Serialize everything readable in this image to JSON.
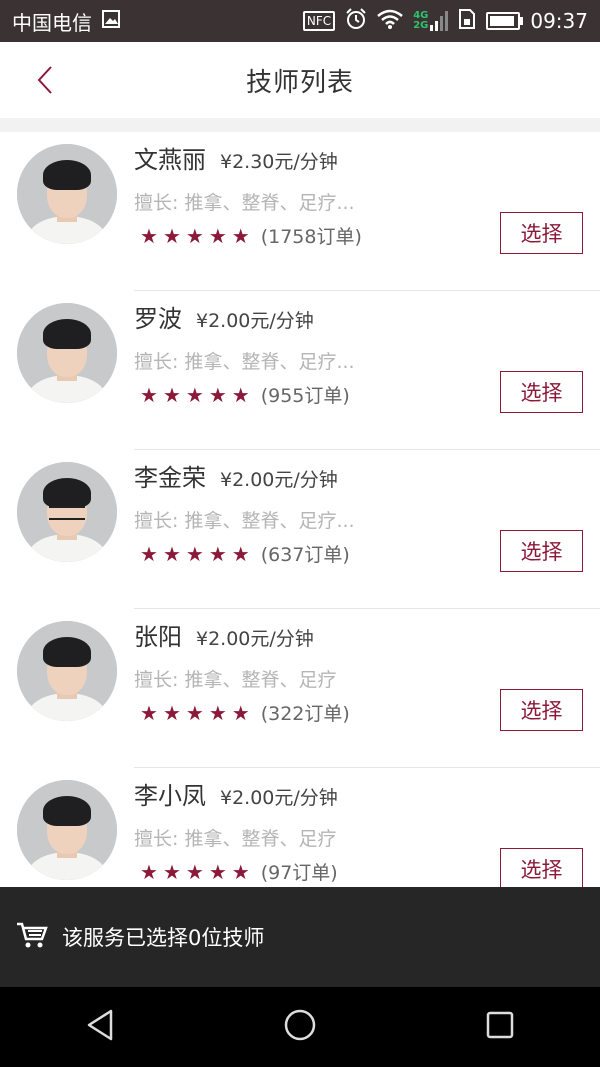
{
  "status_bar": {
    "carrier": "中国电信",
    "network_4g": "4G",
    "network_2g": "2G",
    "nfc_label": "NFC",
    "time": "09:37",
    "icons": [
      "image-icon",
      "nfc-icon",
      "alarm-icon",
      "wifi-icon",
      "signal-icon",
      "sim-icon",
      "battery-icon"
    ]
  },
  "header": {
    "title": "技师列表",
    "back_icon": "chevron-left-icon"
  },
  "technicians": [
    {
      "name": "文燕丽",
      "price": "¥2.30元/分钟",
      "skills": "擅长:  推拿、整脊、足疗...",
      "stars": 5,
      "orders": "(1758订单)",
      "select_label": "选择",
      "glasses": false
    },
    {
      "name": "罗波",
      "price": "¥2.00元/分钟",
      "skills": "擅长:  推拿、整脊、足疗...",
      "stars": 5,
      "orders": "(955订单)",
      "select_label": "选择",
      "glasses": false
    },
    {
      "name": "李金荣",
      "price": "¥2.00元/分钟",
      "skills": "擅长:  推拿、整脊、足疗...",
      "stars": 5,
      "orders": "(637订单)",
      "select_label": "选择",
      "glasses": true
    },
    {
      "name": "张阳",
      "price": "¥2.00元/分钟",
      "skills": "擅长:  推拿、整脊、足疗",
      "stars": 5,
      "orders": "(322订单)",
      "select_label": "选择",
      "glasses": false
    },
    {
      "name": "李小凤",
      "price": "¥2.00元/分钟",
      "skills": "擅长:  推拿、整脊、足疗",
      "stars": 5,
      "orders": "(97订单)",
      "select_label": "选择",
      "glasses": false
    }
  ],
  "footer": {
    "cart_icon": "cart-icon",
    "text": "该服务已选择0位技师"
  },
  "nav": {
    "back": "back-triangle-icon",
    "home": "home-circle-icon",
    "recents": "recents-square-icon"
  },
  "colors": {
    "accent": "#8b1a3a",
    "footer_bg": "#262626",
    "status_bg": "#3a3233"
  }
}
